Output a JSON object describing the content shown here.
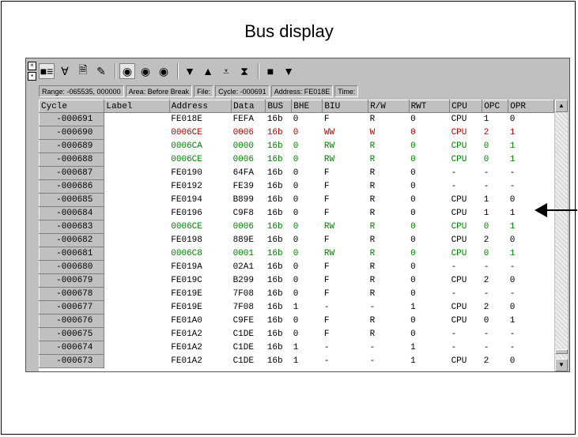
{
  "title": "Bus display",
  "toolbar": {
    "buttons": [
      {
        "icon": "record-icon",
        "glyph": "■≡"
      },
      {
        "icon": "filter-icon",
        "glyph": "∀"
      },
      {
        "icon": "document-icon",
        "glyph": "🗎"
      },
      {
        "icon": "pencil-icon",
        "glyph": "✎"
      },
      {
        "icon": "search-icon",
        "glyph": "◉"
      },
      {
        "icon": "search-next-icon",
        "glyph": "◉"
      },
      {
        "icon": "search-prev-icon",
        "glyph": "◉"
      },
      {
        "icon": "arrow-down-icon",
        "glyph": "▼"
      },
      {
        "icon": "arrow-up-icon",
        "glyph": "▲"
      },
      {
        "icon": "arrow-down-double-icon",
        "glyph": "⩡"
      },
      {
        "icon": "arrow-bottom-icon",
        "glyph": "⧗"
      },
      {
        "icon": "stop-icon",
        "glyph": "■"
      },
      {
        "icon": "dropdown-icon",
        "glyph": "▼"
      }
    ]
  },
  "info": {
    "range": "Range: -065535, 000000",
    "area": "Area: Before Break",
    "file": "File:",
    "cycle": "Cycle: -000691",
    "address": "Address: FE018E",
    "time": "Time:"
  },
  "columns": [
    "Cycle",
    "Label",
    "Address",
    "Data",
    "BUS",
    "BHE",
    "BIU",
    "R/W",
    "RWT",
    "CPU",
    "OPC",
    "OPR"
  ],
  "rows": [
    {
      "style": "normal",
      "cells": [
        "-000691",
        "",
        "FE018E",
        "FEFA",
        "16b",
        "0",
        "F",
        "R",
        "0",
        "CPU",
        "1",
        "0"
      ]
    },
    {
      "style": "red",
      "cells": [
        "-000690",
        "",
        "0006CE",
        "0006",
        "16b",
        "0",
        "WW",
        "W",
        "0",
        "CPU",
        "2",
        "1"
      ]
    },
    {
      "style": "green",
      "cells": [
        "-000689",
        "",
        "0006CA",
        "0000",
        "16b",
        "0",
        "RW",
        "R",
        "0",
        "CPU",
        "0",
        "1"
      ]
    },
    {
      "style": "green",
      "cells": [
        "-000688",
        "",
        "0006CE",
        "0006",
        "16b",
        "0",
        "RW",
        "R",
        "0",
        "CPU",
        "0",
        "1"
      ]
    },
    {
      "style": "normal",
      "cells": [
        "-000687",
        "",
        "FE0190",
        "64FA",
        "16b",
        "0",
        "F",
        "R",
        "0",
        "-",
        "-",
        "-"
      ]
    },
    {
      "style": "normal",
      "cells": [
        "-000686",
        "",
        "FE0192",
        "FE39",
        "16b",
        "0",
        "F",
        "R",
        "0",
        "-",
        "-",
        "-"
      ]
    },
    {
      "style": "normal",
      "cells": [
        "-000685",
        "",
        "FE0194",
        "B899",
        "16b",
        "0",
        "F",
        "R",
        "0",
        "CPU",
        "1",
        "0"
      ]
    },
    {
      "style": "normal",
      "cells": [
        "-000684",
        "",
        "FE0196",
        "C9F8",
        "16b",
        "0",
        "F",
        "R",
        "0",
        "CPU",
        "1",
        "1"
      ]
    },
    {
      "style": "green",
      "cells": [
        "-000683",
        "",
        "0006CE",
        "0006",
        "16b",
        "0",
        "RW",
        "R",
        "0",
        "CPU",
        "0",
        "1"
      ]
    },
    {
      "style": "normal",
      "cells": [
        "-000682",
        "",
        "FE0198",
        "889E",
        "16b",
        "0",
        "F",
        "R",
        "0",
        "CPU",
        "2",
        "0"
      ]
    },
    {
      "style": "green",
      "cells": [
        "-000681",
        "",
        "0006C8",
        "0001",
        "16b",
        "0",
        "RW",
        "R",
        "0",
        "CPU",
        "0",
        "1"
      ]
    },
    {
      "style": "normal",
      "cells": [
        "-000680",
        "",
        "FE019A",
        "02A1",
        "16b",
        "0",
        "F",
        "R",
        "0",
        "-",
        "-",
        "-"
      ]
    },
    {
      "style": "normal",
      "cells": [
        "-000679",
        "",
        "FE019C",
        "B299",
        "16b",
        "0",
        "F",
        "R",
        "0",
        "CPU",
        "2",
        "0"
      ]
    },
    {
      "style": "normal",
      "cells": [
        "-000678",
        "",
        "FE019E",
        "7F08",
        "16b",
        "0",
        "F",
        "R",
        "0",
        "-",
        "-",
        "-"
      ]
    },
    {
      "style": "normal",
      "cells": [
        "-000677",
        "",
        "FE019E",
        "7F08",
        "16b",
        "1",
        "-",
        "-",
        "1",
        "CPU",
        "2",
        "0"
      ]
    },
    {
      "style": "normal",
      "cells": [
        "-000676",
        "",
        "FE01A0",
        "C9FE",
        "16b",
        "0",
        "F",
        "R",
        "0",
        "CPU",
        "0",
        "1"
      ]
    },
    {
      "style": "normal",
      "cells": [
        "-000675",
        "",
        "FE01A2",
        "C1DE",
        "16b",
        "0",
        "F",
        "R",
        "0",
        "-",
        "-",
        "-"
      ]
    },
    {
      "style": "normal",
      "cells": [
        "-000674",
        "",
        "FE01A2",
        "C1DE",
        "16b",
        "1",
        "-",
        "-",
        "1",
        "-",
        "-",
        "-"
      ]
    },
    {
      "style": "normal",
      "cells": [
        "-000673",
        "",
        "FE01A2",
        "C1DE",
        "16b",
        "1",
        "-",
        "-",
        "1",
        "CPU",
        "2",
        "0"
      ]
    }
  ]
}
